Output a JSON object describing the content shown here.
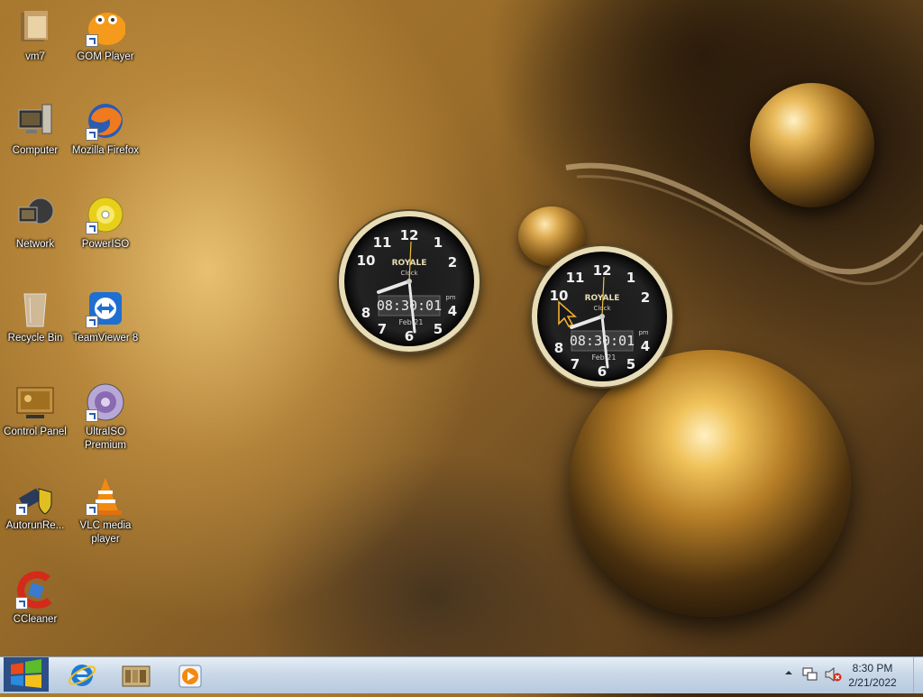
{
  "desktop": {
    "icons": [
      {
        "label": "vm7",
        "icon": "folder-icon"
      },
      {
        "label": "GOM Player",
        "icon": "gom-player-icon"
      },
      {
        "label": "Computer",
        "icon": "computer-icon"
      },
      {
        "label": "Mozilla Firefox",
        "icon": "firefox-icon"
      },
      {
        "label": "Network",
        "icon": "network-icon"
      },
      {
        "label": "PowerISO",
        "icon": "poweriso-icon"
      },
      {
        "label": "Recycle Bin",
        "icon": "recycle-bin-icon"
      },
      {
        "label": "TeamViewer 8",
        "icon": "teamviewer-icon"
      },
      {
        "label": "Control Panel",
        "icon": "control-panel-icon"
      },
      {
        "label": "UltraISO Premium",
        "icon": "ultraiso-icon"
      },
      {
        "label": "AutorunRe...",
        "icon": "autorun-icon"
      },
      {
        "label": "VLC media player",
        "icon": "vlc-icon"
      },
      {
        "label": "CCleaner",
        "icon": "ccleaner-icon"
      }
    ]
  },
  "gadgets": {
    "clocks": [
      {
        "brand": "ROYALE",
        "sub": "Clock",
        "time": "08:30:01",
        "ampm": "pm",
        "date": "Feb 21",
        "numerals": [
          "12",
          "1",
          "2",
          "4",
          "5",
          "6",
          "7",
          "8",
          "10",
          "11"
        ]
      },
      {
        "brand": "ROYALE",
        "sub": "Clock",
        "time": "08:30:01",
        "ampm": "pm",
        "date": "Feb 21",
        "numerals": [
          "12",
          "1",
          "2",
          "4",
          "5",
          "6",
          "7",
          "8",
          "10",
          "11"
        ]
      }
    ]
  },
  "taskbar": {
    "start_icon": "windows-start-icon",
    "pinned": [
      {
        "name": "Internet Explorer",
        "icon": "internet-explorer-icon"
      },
      {
        "name": "Libraries",
        "icon": "libraries-icon"
      },
      {
        "name": "Windows Media Player",
        "icon": "media-player-icon"
      }
    ],
    "tray": {
      "time": "8:30 PM",
      "date": "2/21/2022",
      "icons": [
        "show-hidden-icons-icon",
        "network-tray-icon",
        "volume-muted-icon"
      ]
    }
  },
  "colors": {
    "label_text": "#ffffff",
    "taskbar_top": "#e6eef6",
    "taskbar_bottom": "#b7c9dd",
    "clock_bezel": "#e8dcb6",
    "clock_face": "#1a1a1a"
  }
}
